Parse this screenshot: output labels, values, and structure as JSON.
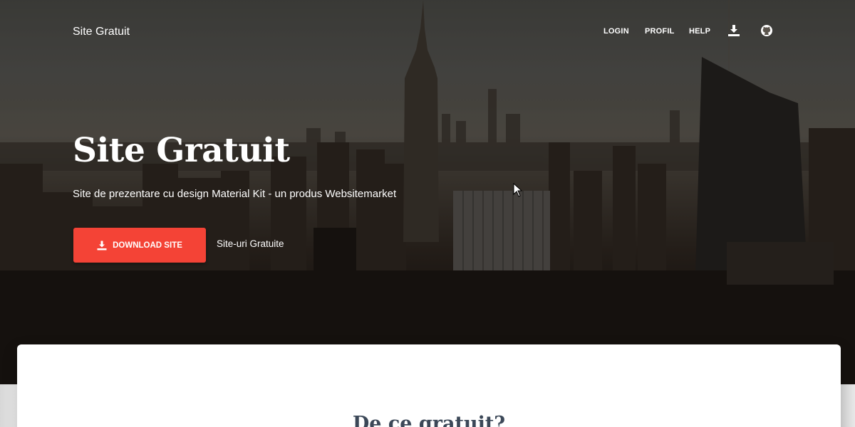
{
  "navbar": {
    "brand": "Site Gratuit",
    "items": [
      {
        "label": "LOGIN"
      },
      {
        "label": "PROFIL"
      },
      {
        "label": "HELP"
      }
    ],
    "icons": [
      "download-icon",
      "github-icon"
    ]
  },
  "hero": {
    "title": "Site Gratuit",
    "subtitle": "Site de prezentare cu design Material Kit - un produs Websitemarket",
    "download_button": "DOWNLOAD SITE",
    "secondary_link": "Site-uri Gratuite"
  },
  "section": {
    "title": "De ce gratuit?"
  },
  "colors": {
    "accent": "#f44336",
    "heading": "#3c4858",
    "white": "#ffffff"
  }
}
